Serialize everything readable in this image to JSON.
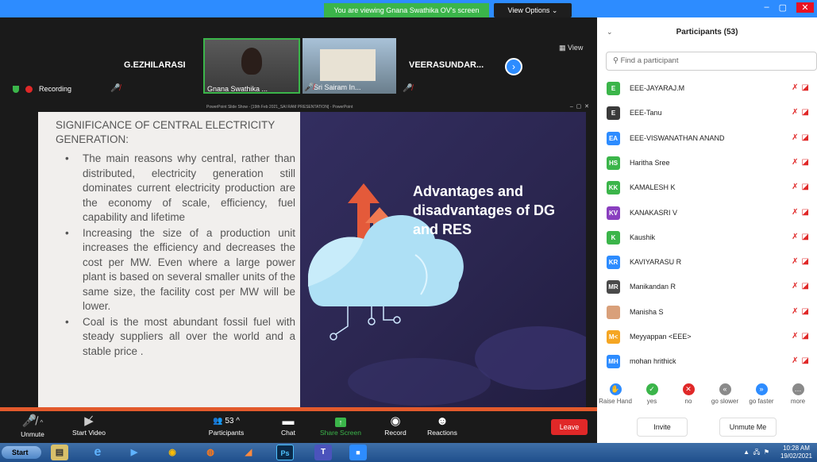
{
  "zoom": {
    "banner": "You are viewing Gnana Swathika OV's screen",
    "view_options": "View Options ⌄",
    "window_controls": {
      "min": "–",
      "max": "▢",
      "close": "✕"
    },
    "thumbnails": [
      {
        "name": "G.EZHILARASI"
      },
      {
        "name": "Gnana Swathika ..."
      },
      {
        "name": "Sri Sairam In..."
      },
      {
        "name": "VEERASUNDAR..."
      }
    ],
    "view_label": "View",
    "recording_label": "Recording",
    "ppt_title": "PowerPoint Slide Show - [19th Feb 2021_SAI RAM PRESENTATION] - PowerPoint",
    "toolbar": {
      "unmute": "Unmute",
      "start_video": "Start Video",
      "participants": "Participants",
      "participants_count": "53",
      "chat": "Chat",
      "share_screen": "Share Screen",
      "record": "Record",
      "reactions": "Reactions",
      "leave": "Leave"
    }
  },
  "slide": {
    "title": "SIGNIFICANCE OF CENTRAL ELECTRICITY GENERATION:",
    "bullet1": "The main reasons why central, rather than distributed, electricity generation still dominates current electricity production are the economy of scale, efficiency, fuel capability and lifetime",
    "bullet2": "Increasing the size of a production unit increases the efficiency and decreases the cost per MW. Even where a large power plant is based on several smaller units of the same size, the facility cost per MW will be lower.",
    "bullet3": "Coal is the most abundant fossil fuel with steady suppliers all over the world and a stable price .",
    "right_heading": "Advantages and disadvantages of DG and RES"
  },
  "participants_panel": {
    "title": "Participants (53)",
    "search_placeholder": "Find a participant",
    "people": [
      {
        "initials": "E",
        "name": "EEE-JAYARAJ.M",
        "color": "#3bb54a"
      },
      {
        "initials": "E",
        "name": "EEE-Tanu",
        "color": "#3a3a3a"
      },
      {
        "initials": "EA",
        "name": "EEE-VISWANATHAN ANAND",
        "color": "#2d8cff"
      },
      {
        "initials": "HS",
        "name": "Haritha Sree",
        "color": "#3bb54a"
      },
      {
        "initials": "KK",
        "name": "KAMALESH K",
        "color": "#3bb54a"
      },
      {
        "initials": "KV",
        "name": "KANAKASRI V",
        "color": "#8a3fbf"
      },
      {
        "initials": "K",
        "name": "Kaushik",
        "color": "#3bb54a"
      },
      {
        "initials": "KR",
        "name": "KAVIYARASU R",
        "color": "#2d8cff"
      },
      {
        "initials": "MR",
        "name": "Manikandan R",
        "color": "#4a4a4a"
      },
      {
        "initials": "",
        "name": "Manisha S",
        "color": "#d9a07a"
      },
      {
        "initials": "M<",
        "name": "Meyyappan <EEE>",
        "color": "#f5a623"
      },
      {
        "initials": "MH",
        "name": "mohan hrithick",
        "color": "#2d8cff"
      }
    ],
    "reactions": [
      {
        "label": "Raise Hand",
        "glyph": "✋",
        "color": "#2d8cff"
      },
      {
        "label": "yes",
        "glyph": "✓",
        "color": "#3bb54a"
      },
      {
        "label": "no",
        "glyph": "✕",
        "color": "#e02828"
      },
      {
        "label": "go slower",
        "glyph": "«",
        "color": "#8a8a8a"
      },
      {
        "label": "go faster",
        "glyph": "»",
        "color": "#2d8cff"
      },
      {
        "label": "more",
        "glyph": "…",
        "color": "#8a8a8a"
      }
    ],
    "invite": "Invite",
    "unmute_me": "Unmute Me"
  },
  "taskbar": {
    "start": "Start",
    "time": "10:28 AM",
    "date": "19/02/2021"
  }
}
